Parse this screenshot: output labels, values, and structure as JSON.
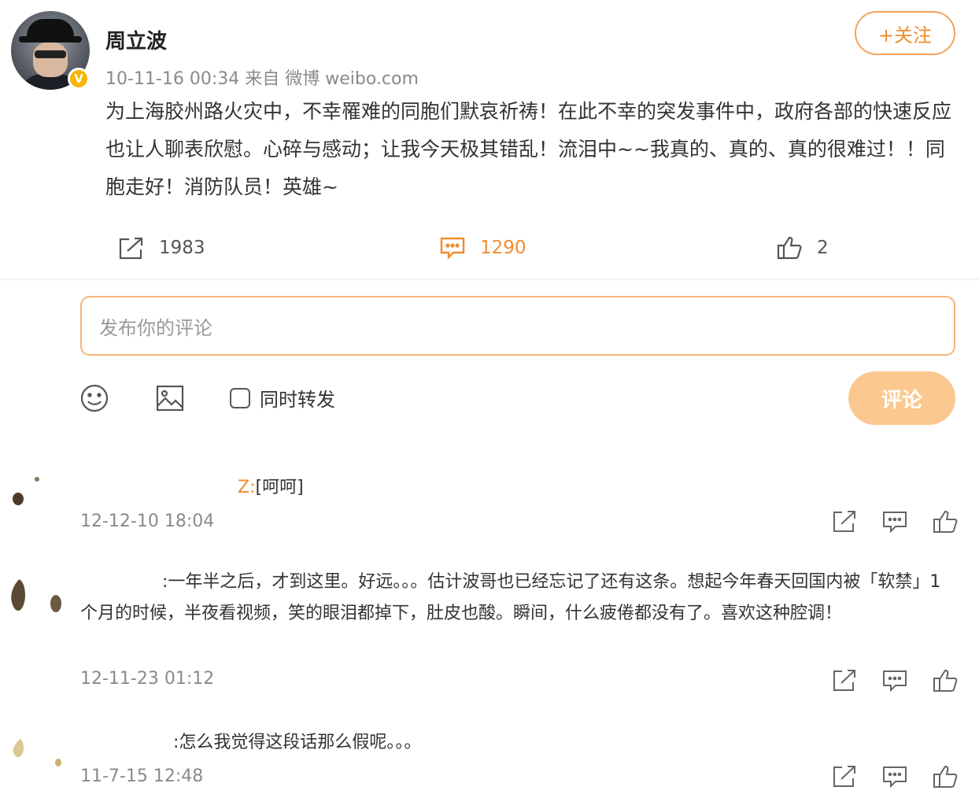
{
  "post": {
    "author": "周立波",
    "verified_badge": "V",
    "meta": "10-11-16 00:34 来自 微博 weibo.com",
    "follow_label": "+关注",
    "text": "为上海胶州路火灾中，不幸罹难的同胞们默哀祈祷！在此不幸的突发事件中，政府各部的快速反应也让人聊表欣慰。心碎与感动；让我今天极其错乱！流泪中~~我真的、真的、真的很难过！！同胞走好！消防队员！英雄~",
    "repost_count": "1983",
    "comment_count": "1290",
    "like_count": "2"
  },
  "composer": {
    "placeholder": "发布你的评论",
    "repost_label": "同时转发",
    "submit_label": "评论"
  },
  "comments": [
    {
      "name": "Z:",
      "text": "[呵呵]",
      "time": "12-12-10 18:04"
    },
    {
      "name": "",
      "text": ":一年半之后，才到这里。好远。。。估计波哥也已经忘记了还有这条。想起今年春天回国内被「软禁」1个月的时候，半夜看视频，笑的眼泪都掉下，肚皮也酸。瞬间，什么疲倦都没有了。喜欢这种腔调！",
      "time": "12-11-23 01:12"
    },
    {
      "name": "",
      "text": ":怎么我觉得这段话那么假呢。。。",
      "time": "11-7-15 12:48"
    }
  ],
  "colors": {
    "accent": "#f08c2e",
    "input_border": "#f5b574",
    "submit_bg": "#fbc88f"
  },
  "icons": [
    "repost-icon",
    "comment-icon",
    "like-icon",
    "emoji-icon",
    "image-icon"
  ]
}
